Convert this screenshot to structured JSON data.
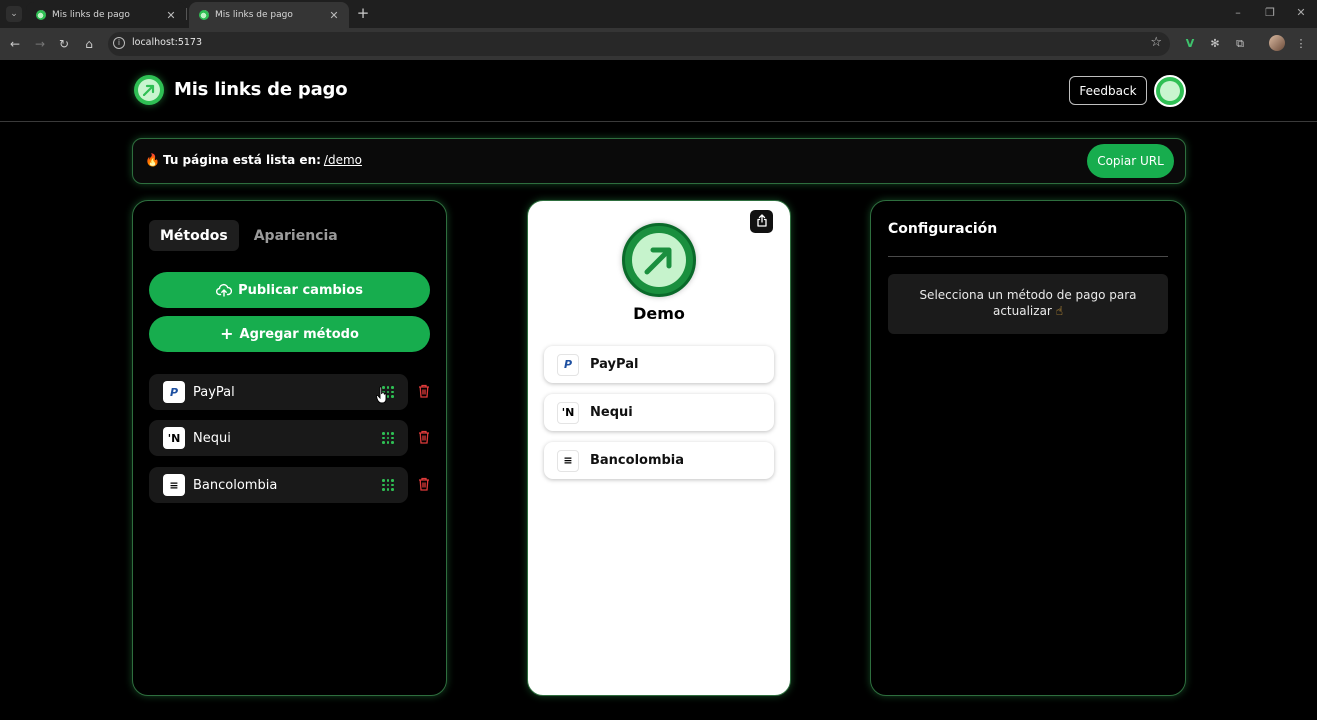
{
  "browser": {
    "tabs": [
      {
        "title": "Mis links de pago",
        "active": false
      },
      {
        "title": "Mis links de pago",
        "active": true
      }
    ],
    "url": "localhost:5173"
  },
  "header": {
    "title": "Mis links de pago",
    "feedback_label": "Feedback"
  },
  "banner": {
    "text": "Tu página está lista en:",
    "link": "/demo",
    "copy_label": "Copiar URL"
  },
  "left_panel": {
    "tabs": [
      {
        "label": "Métodos",
        "active": true
      },
      {
        "label": "Apariencia",
        "active": false
      }
    ],
    "publish_label": "Publicar cambios",
    "add_label": "Agregar método",
    "methods": [
      {
        "name": "PayPal",
        "icon": "paypal-icon"
      },
      {
        "name": "Nequi",
        "icon": "nequi-icon"
      },
      {
        "name": "Bancolombia",
        "icon": "bancolombia-icon"
      }
    ]
  },
  "preview": {
    "name": "Demo",
    "methods": [
      {
        "name": "PayPal",
        "icon": "paypal-icon"
      },
      {
        "name": "Nequi",
        "icon": "nequi-icon"
      },
      {
        "name": "Bancolombia",
        "icon": "bancolombia-icon"
      }
    ]
  },
  "config": {
    "title": "Configuración",
    "message": "Selecciona un método de pago para actualizar"
  },
  "colors": {
    "accent": "#17ad4e",
    "danger": "#e03b3b",
    "background": "#000000"
  }
}
